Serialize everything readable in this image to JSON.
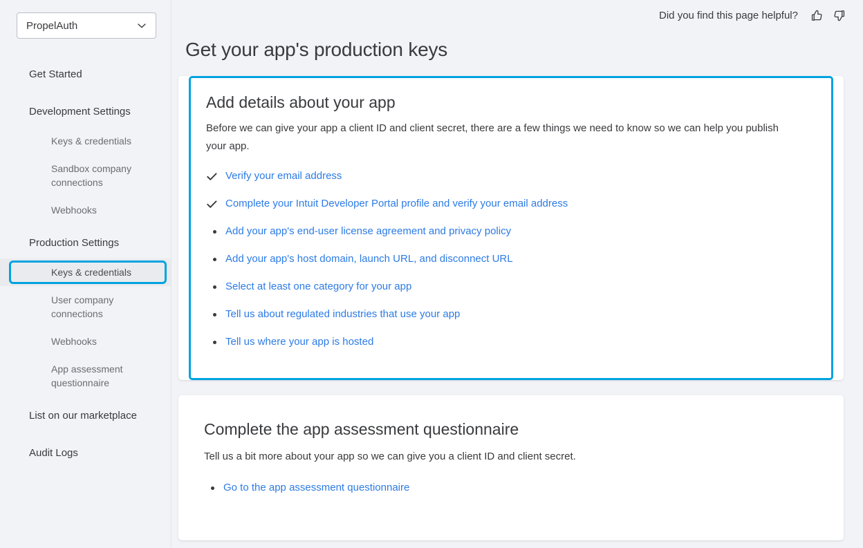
{
  "sidebar": {
    "org_select": {
      "value": "PropelAuth",
      "icon": "chevron-down-icon"
    },
    "nav": [
      {
        "label": "Get Started",
        "level": "top",
        "active": false
      },
      {
        "label": "Development Settings",
        "level": "top",
        "active": false
      },
      {
        "label": "Keys & credentials",
        "level": "sub",
        "active": false
      },
      {
        "label": "Sandbox company connections",
        "level": "sub",
        "active": false
      },
      {
        "label": "Webhooks",
        "level": "sub",
        "active": false
      },
      {
        "label": "Production Settings",
        "level": "top",
        "active": false
      },
      {
        "label": "Keys & credentials",
        "level": "sub",
        "active": true
      },
      {
        "label": "User company connections",
        "level": "sub",
        "active": false
      },
      {
        "label": "Webhooks",
        "level": "sub",
        "active": false
      },
      {
        "label": "App assessment questionnaire",
        "level": "sub",
        "active": false
      },
      {
        "label": "List on our marketplace",
        "level": "top",
        "active": false
      },
      {
        "label": "Audit Logs",
        "level": "top",
        "active": false
      }
    ]
  },
  "topbar": {
    "feedback_label": "Did you find this page helpful?",
    "thumbs_up_icon": "thumbs-up-icon",
    "thumbs_down_icon": "thumbs-down-icon"
  },
  "page": {
    "title": "Get your app's production keys"
  },
  "details_card": {
    "title": "Add details about your app",
    "description": "Before we can give your app a client ID and client secret, there are a few things we need to know so we can help you publish your app.",
    "items": [
      {
        "label": "Verify your email address",
        "marker": "check"
      },
      {
        "label": "Complete your Intuit Developer Portal profile and verify your email address",
        "marker": "check"
      },
      {
        "label": "Add your app's end-user license agreement and privacy policy",
        "marker": "bullet"
      },
      {
        "label": "Add your app's host domain, launch URL, and disconnect URL",
        "marker": "bullet"
      },
      {
        "label": "Select at least one category for your app",
        "marker": "bullet"
      },
      {
        "label": "Tell us about regulated industries that use your app",
        "marker": "bullet"
      },
      {
        "label": "Tell us where your app is hosted",
        "marker": "bullet"
      }
    ]
  },
  "questionnaire_card": {
    "title": "Complete the app assessment questionnaire",
    "description": "Tell us a bit more about your app so we can give you a client ID and client secret.",
    "items": [
      {
        "label": "Go to the app assessment questionnaire",
        "marker": "bullet"
      }
    ]
  },
  "colors": {
    "page_bg": "#f2f3f6",
    "card_bg": "#ffffff",
    "focus_ring": "#00a3e0",
    "accent_bar": "#0c7ac4",
    "link": "#2c7be5",
    "text": "#393a3d",
    "muted_text": "#6b6c72"
  }
}
